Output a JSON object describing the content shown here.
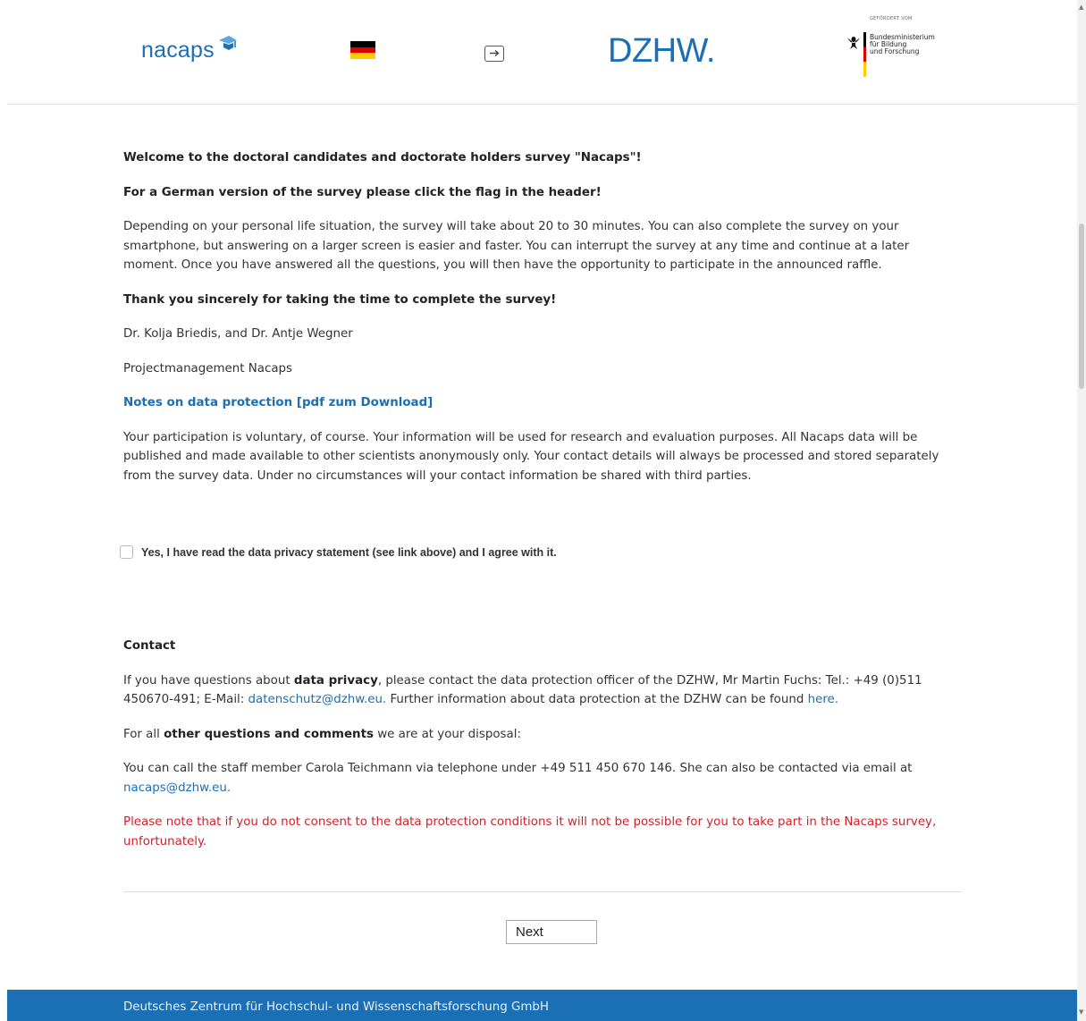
{
  "header": {
    "nacaps_logo": "nacaps",
    "dzhw_logo": "DZHW.",
    "bmbf": {
      "funded_by": "GEFÖRDERT VOM",
      "line1": "Bundesministerium",
      "line2": "für Bildung",
      "line3": "und Forschung"
    },
    "flag_colors": [
      "#000000",
      "#dd0000",
      "#ffce00"
    ],
    "language_icon": "sign-in-icon"
  },
  "content": {
    "welcome": "Welcome to the doctoral candidates and doctorate holders survey \"Nacaps\"!",
    "german_hint": "For a German version of the survey please click the flag in the header!",
    "intro": "Depending on your personal life situation, the survey will take about 20 to 30 minutes. You can also complete the survey on your smartphone, but answering on a larger screen is easier and faster. You can interrupt the survey at any time and continue at a later moment. Once you have answered all the questions, you will then have the opportunity to participate in the announced raffle.",
    "thanks": "Thank you sincerely for taking the time to complete the survey!",
    "signatories": "Dr. Kolja Briedis, and Dr. Antje Wegner",
    "team": "Projectmanagement Nacaps",
    "privacy_link": "Notes on data protection [pdf zum Download]",
    "privacy_text": "Your participation is voluntary, of course. Your information will be used for research and evaluation purposes. All Nacaps data will be published and made available to other scientists anonymously only. Your contact details will always be processed and stored separately from the survey data. Under no circumstances will your contact information be shared with third parties."
  },
  "consent": {
    "label": "Yes, I have read the data privacy statement (see link above) and I agree with it.",
    "checked": false
  },
  "contact": {
    "heading": "Contact",
    "privacy_pre": "If you have questions about ",
    "privacy_bold": "data privacy",
    "privacy_mid": ", please contact the data protection officer of the DZHW, Mr Martin Fuchs: Tel.: +49 (0)511 450670-491; E-Mail: ",
    "privacy_email": "datenschutz@dzhw.eu.",
    "privacy_post": " Further information about data protection at the DZHW can be found ",
    "privacy_here": "here.",
    "other_pre": "For all ",
    "other_bold": "other questions and comments",
    "other_post": " we are at your disposal:",
    "staff_pre": "You can call the staff member Carola Teichmann via telephone under +49 511 450 670 146. She can also be contacted via email at ",
    "staff_email": "nacaps@dzhw.eu.",
    "warning": "Please note that if you do not consent to the data protection conditions it will not be possible for you to take part in the Nacaps survey, unfortunately."
  },
  "navigation": {
    "next_label": "Next"
  },
  "footer": {
    "text": "Deutsches Zentrum für Hochschul- und Wissenschaftsforschung GmbH",
    "color": "#1a6fb5"
  }
}
